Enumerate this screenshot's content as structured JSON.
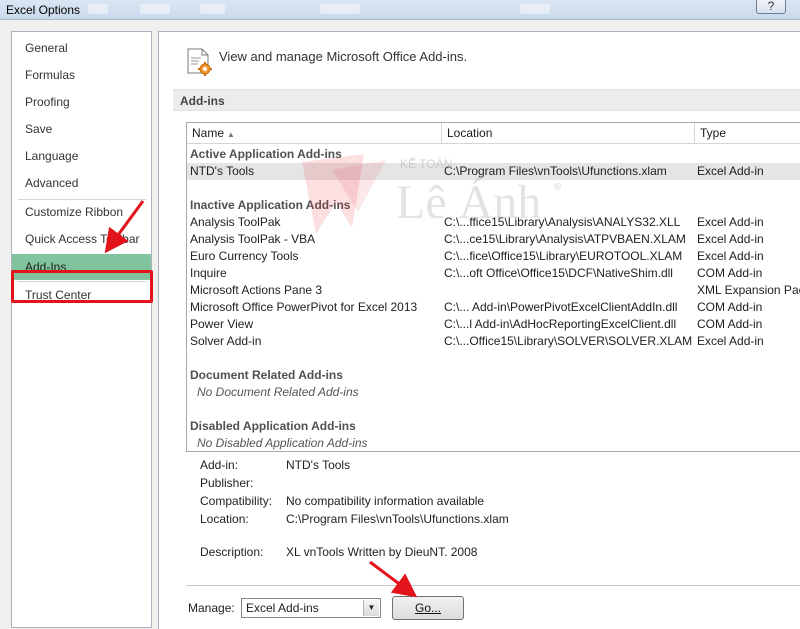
{
  "window": {
    "title": "Excel Options",
    "help_label": "?"
  },
  "sidebar": {
    "items": [
      {
        "label": "General"
      },
      {
        "label": "Formulas"
      },
      {
        "label": "Proofing"
      },
      {
        "label": "Save"
      },
      {
        "label": "Language"
      },
      {
        "label": "Advanced"
      },
      {
        "label": "Customize Ribbon"
      },
      {
        "label": "Quick Access Toolbar"
      },
      {
        "label": "Add-Ins",
        "selected": true
      },
      {
        "label": "Trust Center"
      }
    ]
  },
  "header": {
    "text": "View and manage Microsoft Office Add-ins.",
    "icon": "addins-gear-icon"
  },
  "section": {
    "title": "Add-ins"
  },
  "table": {
    "columns": [
      "Name",
      "Location",
      "Type"
    ],
    "sort_indicator": "▲",
    "groups": {
      "active": {
        "title": "Active Application Add-ins",
        "rows": [
          {
            "name": "NTD's Tools",
            "location": "C:\\Program Files\\vnTools\\Ufunctions.xlam",
            "type": "Excel Add-in",
            "selected": true
          }
        ]
      },
      "inactive": {
        "title": "Inactive Application Add-ins",
        "rows": [
          {
            "name": "Analysis ToolPak",
            "location": "C:\\...ffice15\\Library\\Analysis\\ANALYS32.XLL",
            "type": "Excel Add-in"
          },
          {
            "name": "Analysis ToolPak - VBA",
            "location": "C:\\...ce15\\Library\\Analysis\\ATPVBAEN.XLAM",
            "type": "Excel Add-in"
          },
          {
            "name": "Euro Currency Tools",
            "location": "C:\\...fice\\Office15\\Library\\EUROTOOL.XLAM",
            "type": "Excel Add-in"
          },
          {
            "name": "Inquire",
            "location": "C:\\...oft Office\\Office15\\DCF\\NativeShim.dll",
            "type": "COM Add-in"
          },
          {
            "name": "Microsoft Actions Pane 3",
            "location": "",
            "type": "XML Expansion Pac"
          },
          {
            "name": "Microsoft Office PowerPivot for Excel 2013",
            "location": "C:\\... Add-in\\PowerPivotExcelClientAddIn.dll",
            "type": "COM Add-in"
          },
          {
            "name": "Power View",
            "location": "C:\\...l Add-in\\AdHocReportingExcelClient.dll",
            "type": "COM Add-in"
          },
          {
            "name": "Solver Add-in",
            "location": "C:\\...Office15\\Library\\SOLVER\\SOLVER.XLAM",
            "type": "Excel Add-in"
          }
        ]
      },
      "document": {
        "title": "Document Related Add-ins",
        "empty": "No Document Related Add-ins"
      },
      "disabled": {
        "title": "Disabled Application Add-ins",
        "empty": "No Disabled Application Add-ins"
      }
    }
  },
  "details": {
    "addin_label": "Add-in:",
    "addin_value": "NTD's Tools",
    "publisher_label": "Publisher:",
    "publisher_value": "",
    "compat_label": "Compatibility:",
    "compat_value": "No compatibility information available",
    "location_label": "Location:",
    "location_value": "C:\\Program Files\\vnTools\\Ufunctions.xlam",
    "description_label": "Description:",
    "description_value": "XL vnTools Written by DieuNT. 2008"
  },
  "manage": {
    "label": "Manage:",
    "value": "Excel Add-ins",
    "go_label": "Go..."
  },
  "watermark": {
    "top": "KẾ TOÁN",
    "brand": "Lê Ánh",
    "mark": "®"
  },
  "colors": {
    "selected_nav": "#81c39d",
    "highlight_red": "#e3131b"
  }
}
